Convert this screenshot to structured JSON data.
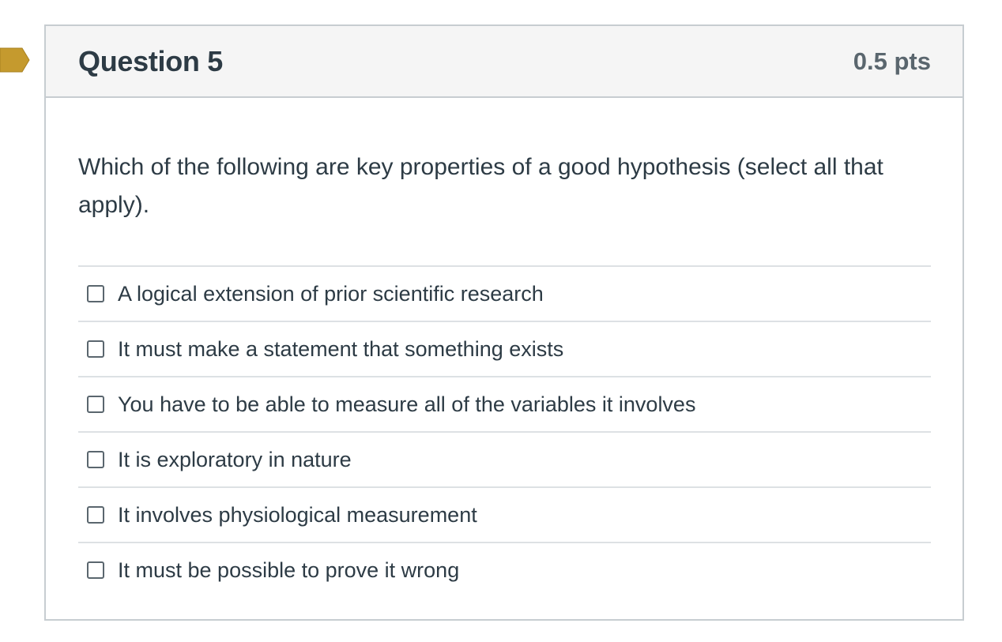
{
  "colors": {
    "flag": "#c59a2e",
    "header_bg": "#f5f5f5",
    "border": "#c7cdd1",
    "text": "#2d3b45"
  },
  "question": {
    "title": "Question 5",
    "points": "0.5 pts",
    "text": "Which of the following are key properties of a good hypothesis (select all that apply).",
    "flag_icon": "bookmark-flag-icon"
  },
  "answers": [
    {
      "label": "A logical extension of prior scientific research",
      "checked": false
    },
    {
      "label": "It must make a statement that something exists",
      "checked": false
    },
    {
      "label": "You have to be able to measure all of the variables it involves",
      "checked": false
    },
    {
      "label": "It is exploratory in nature",
      "checked": false
    },
    {
      "label": "It involves physiological measurement",
      "checked": false
    },
    {
      "label": "It must be possible to prove it wrong",
      "checked": false
    }
  ]
}
